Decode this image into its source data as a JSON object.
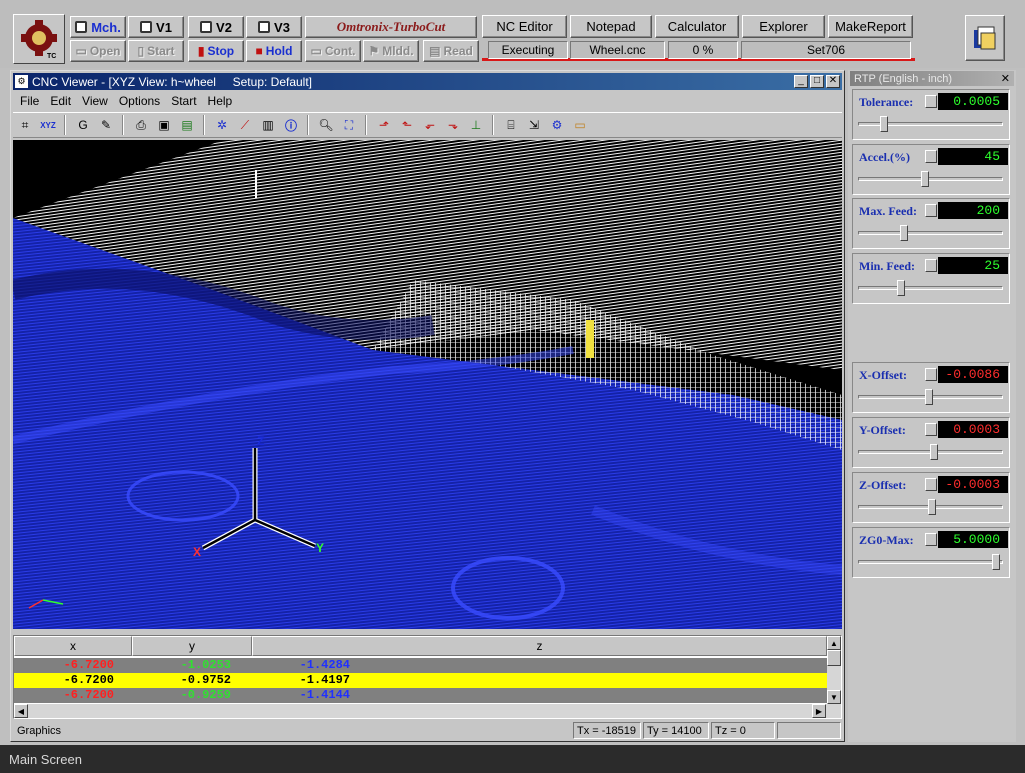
{
  "brand": "Omtronix-TurboCut",
  "machine_buttons": [
    {
      "id": "mch",
      "label": "Mch."
    },
    {
      "id": "v1",
      "label": "V1"
    },
    {
      "id": "v2",
      "label": "V2"
    },
    {
      "id": "v3",
      "label": "V3"
    }
  ],
  "control_buttons": [
    {
      "id": "open",
      "label": "Open",
      "enabled": false
    },
    {
      "id": "start",
      "label": "Start",
      "enabled": false
    },
    {
      "id": "stop",
      "label": "Stop",
      "enabled": true
    },
    {
      "id": "hold",
      "label": "Hold",
      "enabled": true
    },
    {
      "id": "cont",
      "label": "Cont.",
      "enabled": false
    },
    {
      "id": "mldd",
      "label": "Mldd.",
      "enabled": false
    },
    {
      "id": "read",
      "label": "Read",
      "enabled": false
    }
  ],
  "tool_buttons": [
    "NC Editor",
    "Notepad",
    "Calculator",
    "Explorer",
    "MakeReport"
  ],
  "status": {
    "state": "Executing",
    "file": "Wheel.cnc",
    "progress": "0 %",
    "setup": "Set706"
  },
  "viewer": {
    "title": "CNC Viewer - [XYZ View: h~wheel     Setup: Default]",
    "menu": [
      "File",
      "Edit",
      "View",
      "Options",
      "Start",
      "Help"
    ],
    "columns": [
      "x",
      "y",
      "z"
    ],
    "rows": [
      {
        "x": "-6.7200",
        "y": "-1.0253",
        "z": "-1.4284",
        "highlight": false
      },
      {
        "x": "-6.7200",
        "y": "-0.9752",
        "z": "-1.4197",
        "highlight": true
      },
      {
        "x": "-6.7200",
        "y": "-0.9259",
        "z": "-1.4144",
        "highlight": false
      }
    ],
    "statusbar": {
      "mode": "Graphics",
      "tx": "Tx = -18519",
      "ty": "Ty = 14100",
      "tz": "Tz = 0"
    },
    "axis_labels": {
      "x": "X",
      "y": "Y",
      "z": "Z"
    }
  },
  "rtp": {
    "title": "RTP (English - inch)",
    "params": [
      {
        "id": "tolerance",
        "label": "Tolerance:",
        "value": "0.0005",
        "color": "#2dff2d",
        "level": 0.15
      },
      {
        "id": "accel",
        "label": "Accel.(%)",
        "value": "45",
        "color": "#2dff2d",
        "level": 0.45
      },
      {
        "id": "maxfeed",
        "label": "Max. Feed:",
        "value": "200",
        "color": "#2dff2d",
        "level": 0.3
      },
      {
        "id": "minfeed",
        "label": "Min. Feed:",
        "value": "25",
        "color": "#2dff2d",
        "level": 0.28
      },
      {
        "id": "xoffset",
        "label": "X-Offset:",
        "value": "-0.0086",
        "color": "#ff2d2d",
        "level": 0.48
      },
      {
        "id": "yoffset",
        "label": "Y-Offset:",
        "value": "0.0003",
        "color": "#ff2d2d",
        "level": 0.52
      },
      {
        "id": "zoffset",
        "label": "Z-Offset:",
        "value": "-0.0003",
        "color": "#ff2d2d",
        "level": 0.5
      },
      {
        "id": "zg0max",
        "label": "ZG0-Max:",
        "value": "5.0000",
        "color": "#2dff2d",
        "level": 0.97
      }
    ]
  },
  "main_screen": "Main Screen",
  "colors": {
    "title_active": "#0a246a",
    "highlight_row": "#ffff00",
    "mesh_blue": "#1a2bd8"
  }
}
